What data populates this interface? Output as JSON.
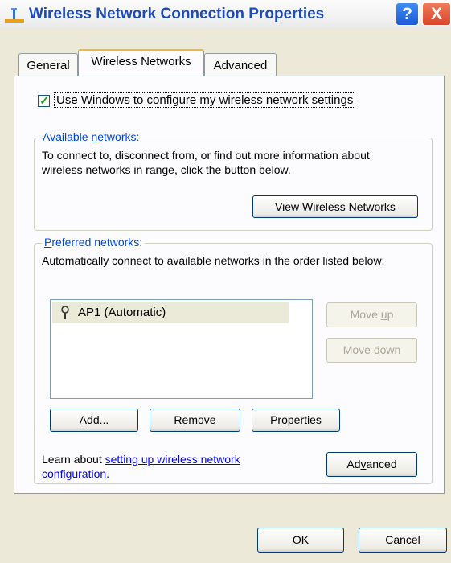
{
  "window": {
    "title": "Wireless Network Connection Properties",
    "help_glyph": "?",
    "close_glyph": "X"
  },
  "tabs": [
    {
      "label": "General",
      "active": false
    },
    {
      "label": "Wireless Networks",
      "active": true
    },
    {
      "label": "Advanced",
      "active": false
    }
  ],
  "wireless": {
    "use_windows_checkbox": {
      "checked": true,
      "label_pre": "Use ",
      "label_accel": "W",
      "label_post": "indows to configure my wireless network settings"
    },
    "available": {
      "legend_pre": "Available ",
      "legend_accel": "n",
      "legend_post": "etworks:",
      "description": "To connect to, disconnect from, or find out more information about wireless networks in range, click the button below.",
      "view_button": "View Wireless Networks"
    },
    "preferred": {
      "legend_accel": "P",
      "legend_post": "referred networks:",
      "description": "Automatically connect to available networks in the order listed below:",
      "networks": [
        {
          "name": "AP1 (Automatic)"
        }
      ],
      "move_up": {
        "pre": "Move ",
        "accel": "u",
        "post": "p"
      },
      "move_down": {
        "pre": "Move ",
        "accel": "d",
        "post": "own"
      },
      "add_button": {
        "pre": "",
        "accel": "A",
        "post": "dd..."
      },
      "remove_button": {
        "pre": "",
        "accel": "R",
        "post": "emove"
      },
      "properties_button": {
        "pre": "Pr",
        "accel": "o",
        "post": "perties"
      }
    },
    "learn_about": {
      "prefix": "Learn about ",
      "link": "setting up wireless network configuration."
    },
    "advanced_button": {
      "pre": "Ad",
      "accel": "v",
      "post": "anced"
    }
  },
  "footer": {
    "ok": "OK",
    "cancel": "Cancel"
  },
  "colors": {
    "dialog_bg": "#ece9d8",
    "title_text": "#1d4ab5",
    "legend_text": "#0046d5",
    "selection_bg": "#ebe9d8",
    "tab_highlight": "#f5b73a"
  }
}
